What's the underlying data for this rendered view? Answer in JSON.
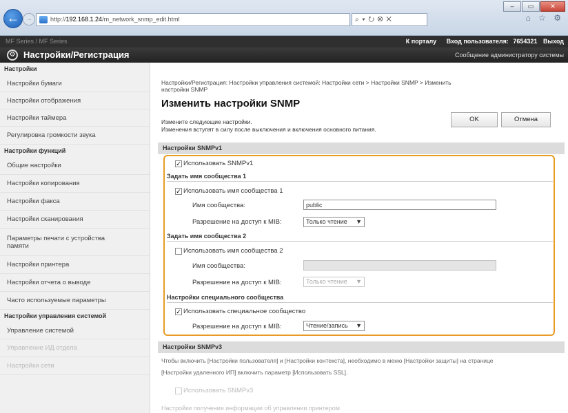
{
  "browser": {
    "url_prefix": "http://",
    "url_host": "192.168.1.24",
    "url_path": "/m_network_snmp_edit.html",
    "url_tools": "⌕ ▾ ⭮ ⭙ ✕",
    "chrome_icons": "⌂ ☆ ⚙",
    "win_minimize": "–",
    "win_restore": "▭",
    "win_close": "✕"
  },
  "topbar": {
    "left_blurred": "MF Series / MF Series",
    "portal_link": "К порталу",
    "user_label": "Вход пользователя:",
    "user_id": "7654321",
    "logout": "Выход"
  },
  "header": {
    "title": "Настройки/Регистрация",
    "admin_msg": "Сообщение администратору системы"
  },
  "sidebar": {
    "section_settings": "Настройки",
    "items_settings": [
      "Настройки бумаги",
      "Настройки отображения",
      "Настройки таймера",
      "Регулировка громкости звука"
    ],
    "section_functions": "Настройки функций",
    "items_functions": [
      "Общие настройки",
      "Настройки копирования",
      "Настройки факса",
      "Настройки сканирования",
      "Параметры печати с устройства",
      "памяти",
      "Настройки принтера",
      "Настройки отчета о выводе",
      "Часто используемые параметры"
    ],
    "section_system": "Настройки управления системой",
    "items_system": [
      "Управление системой",
      "Управление ИД отдела",
      "Настройки сети"
    ]
  },
  "main": {
    "breadcrumb_line1": "Настройки/Регистрация: Настройки управления системой: Настройки сети > Настройки SNMP > Изменить",
    "breadcrumb_line2": "настройки SNMP",
    "title": "Изменить настройки SNMP",
    "desc_line1": "Измените следующие настройки.",
    "desc_line2": "Изменения вступят в силу после выключения и включения основного питания.",
    "ok_button": "OK",
    "cancel_button": "Отмена",
    "snmpv1_header": "Настройки SNMPv1",
    "use_snmpv1": "Использовать SNMPv1",
    "community1_header": "Задать имя сообщества 1",
    "use_community1": "Использовать имя сообщества 1",
    "community_name_label": "Имя сообщества:",
    "community1_value": "public",
    "mib_access_label": "Разрешение на доступ к MIB:",
    "read_only": "Только чтение",
    "community2_header": "Задать имя сообщества 2",
    "use_community2": "Использовать имя сообщества 2",
    "community2_value": "",
    "special_header": "Настройки специального сообщества",
    "use_special": "Использовать специальное сообщество",
    "read_write": "Чтение/запись",
    "snmpv3_header": "Настройки SNMPv3",
    "snmpv3_note1": "Чтобы включить [Настройки пользователя] и [Настройки контекста], необходимо в меню [Настройки защиты] на странице",
    "snmpv3_note2": "[Настройки удаленного ИП] включить параметр [Использовать SSL].",
    "use_snmpv3": "Использовать SNMPv3",
    "bottom_faded": "Настройки получения информации об управлении принтером"
  },
  "colors": {
    "highlight": "#e89b22",
    "header_dark": "#2f2f2f",
    "section_bg": "#dcdcdc"
  }
}
